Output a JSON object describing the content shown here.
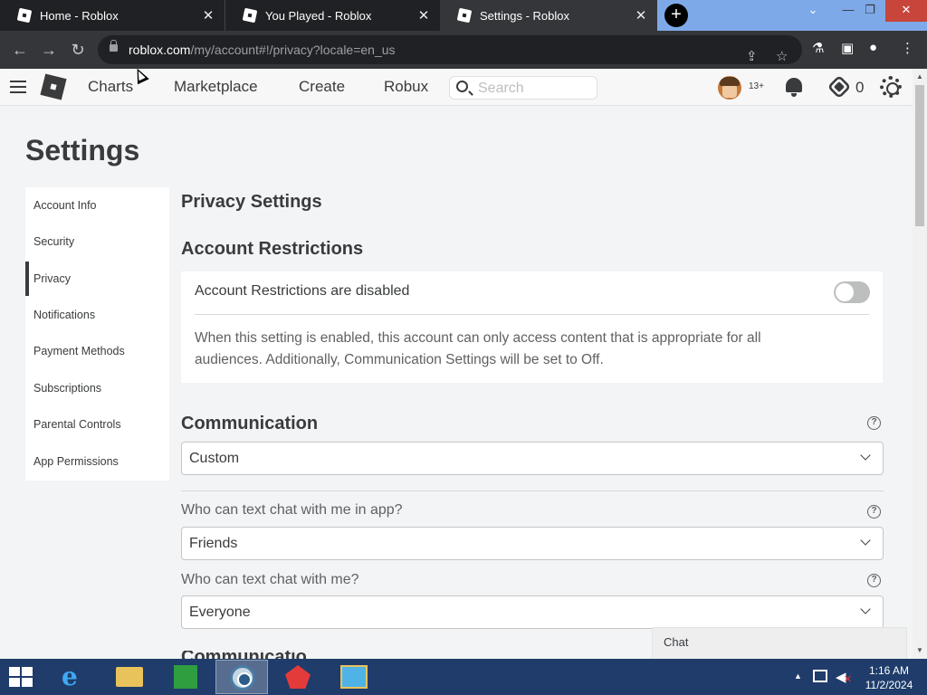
{
  "browser": {
    "tabs": [
      {
        "title": "Home - Roblox",
        "close": "✕"
      },
      {
        "title": "You Played - Roblox",
        "close": "✕"
      },
      {
        "title": "Settings - Roblox",
        "close": "✕"
      }
    ],
    "new_tab": "+",
    "window_controls": {
      "minimize": "—",
      "restore": "❐",
      "close": "✕"
    },
    "url_host": "roblox.com",
    "url_path": "/my/account#!/privacy?locale=en_us"
  },
  "header": {
    "nav": [
      "Charts",
      "Marketplace",
      "Create",
      "Robux"
    ],
    "search_placeholder": "Search",
    "age_badge": "13+",
    "robux_balance": "0"
  },
  "settings": {
    "title": "Settings",
    "sidenav": [
      "Account Info",
      "Security",
      "Privacy",
      "Notifications",
      "Payment Methods",
      "Subscriptions",
      "Parental Controls",
      "App Permissions"
    ],
    "active_item": "Privacy"
  },
  "privacy": {
    "heading": "Privacy Settings",
    "account_restrictions": {
      "heading": "Account Restrictions",
      "toggle_label": "Account Restrictions are disabled",
      "toggle_on": false,
      "description": "When this setting is enabled, this account can only access content that is appropriate for all audiences. Additionally, Communication Settings will be set to Off."
    },
    "communication": {
      "heading": "Communication",
      "help": "?",
      "selected": "Custom"
    },
    "questions": [
      {
        "label": "Who can text chat with me in app?",
        "help": "?",
        "selected": "Friends"
      },
      {
        "label": "Who can text chat with me?",
        "help": "?",
        "selected": "Everyone"
      }
    ],
    "next_heading_peek": "Communication"
  },
  "chat": {
    "label": "Chat"
  },
  "taskbar": {
    "time": "1:16 AM",
    "date": "11/2/2024",
    "ie_glyph": "e"
  }
}
